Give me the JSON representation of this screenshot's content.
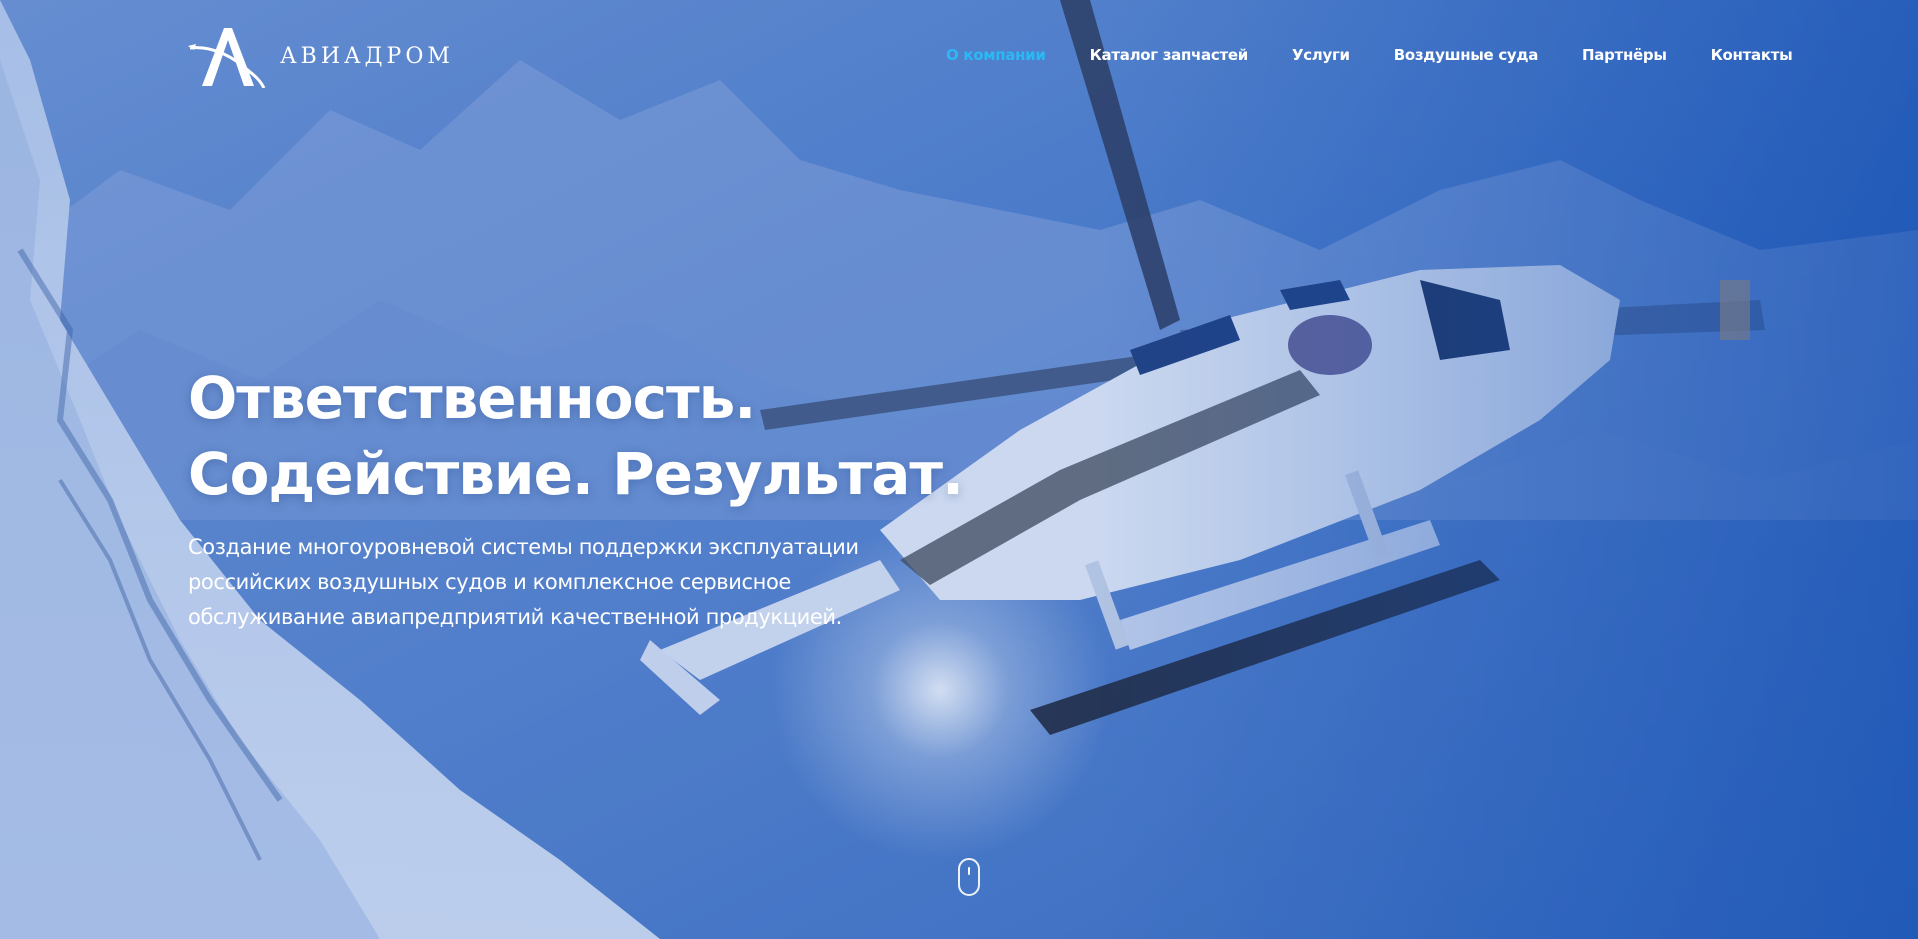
{
  "brand": {
    "name": "АВИАДРОМ",
    "logo_icon": "aviadrom-logo-a-icon"
  },
  "nav": {
    "items": [
      {
        "label": "О компании",
        "active": true
      },
      {
        "label": "Каталог запчастей",
        "active": false
      },
      {
        "label": "Услуги",
        "active": false
      },
      {
        "label": "Воздушные суда",
        "active": false
      },
      {
        "label": "Партнёры",
        "active": false
      },
      {
        "label": "Контакты",
        "active": false
      }
    ],
    "active_color": "#2cb8f5"
  },
  "hero": {
    "headline_line1": "Ответственность.",
    "headline_line2": "Содействие. Результат.",
    "subtitle": "Создание многоуровневой системы поддержки эксплуатации российских воздушных судов и комплексное сервисное обслуживание авиапредприятий качественной продукцией.",
    "background": "helicopter-over-snowy-mountains",
    "overlay_color": "#1f5cc0"
  },
  "scroll_indicator": {
    "icon": "mouse-scroll-icon"
  }
}
